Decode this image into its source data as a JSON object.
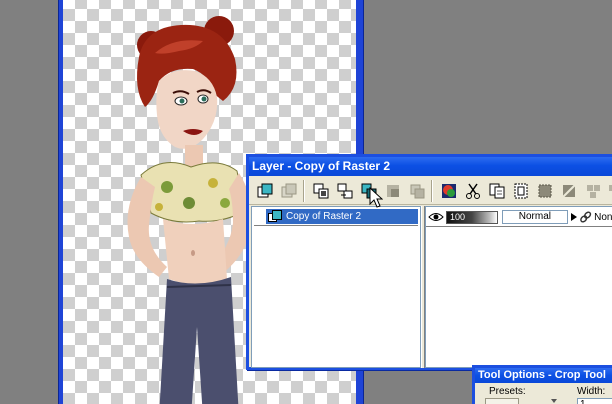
{
  "layer_palette": {
    "title": "Layer - Copy of Raster 2",
    "layers": [
      {
        "name": "Copy of Raster 2",
        "selected": true
      }
    ],
    "properties": {
      "opacity": "100",
      "blend_mode": "Normal",
      "link": "None"
    },
    "toolbar": [
      "new-raster-layer-icon",
      "new-vector-layer-icon",
      "duplicate-layer-icon",
      "delete-layer-icon",
      "merge-layer-icon",
      "move-up-icon",
      "move-down-icon",
      "layer-properties-icon",
      "cut-icon",
      "copy-icon",
      "paste-icon",
      "select-all-icon",
      "select-none-icon",
      "edit-selection-icon",
      "group-icon",
      "ungroup-icon"
    ]
  },
  "tool_options": {
    "title": "Tool Options - Crop Tool",
    "presets_label": "Presets:",
    "width_label": "Width:",
    "width_value": "1"
  },
  "colors": {
    "titlebar_blue": "#0c50e4",
    "selection_blue": "#316ac5",
    "canvas_border": "#1f44d6",
    "desktop_gray": "#808080"
  }
}
